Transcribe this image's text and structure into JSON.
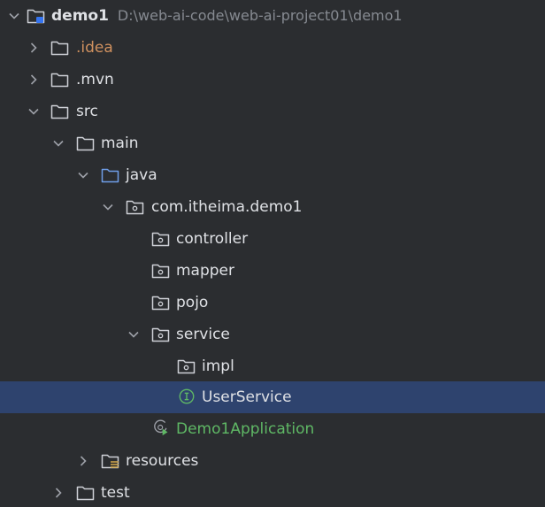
{
  "colors": {
    "background": "#2b2d30",
    "selection": "#2e436e",
    "text": "#dfe1e5",
    "muted": "#868a91",
    "excluded": "#d0915f",
    "application": "#5fb865",
    "source_folder": "#6f9ee8",
    "interface": "#5fb865"
  },
  "tree": {
    "root": {
      "name": "demo1",
      "path": "D:\\web-ai-code\\web-ai-project01\\demo1",
      "icon": "module-folder-icon",
      "expanded": true
    },
    "idea": {
      "name": ".idea",
      "icon": "folder-icon",
      "expanded": false
    },
    "mvn": {
      "name": ".mvn",
      "icon": "folder-icon",
      "expanded": false
    },
    "src": {
      "name": "src",
      "icon": "folder-icon",
      "expanded": true
    },
    "main": {
      "name": "main",
      "icon": "folder-icon",
      "expanded": true
    },
    "java": {
      "name": "java",
      "icon": "source-folder-icon",
      "expanded": true
    },
    "pkg": {
      "name": "com.itheima.demo1",
      "icon": "package-icon",
      "expanded": true
    },
    "controller": {
      "name": "controller",
      "icon": "package-icon"
    },
    "mapper": {
      "name": "mapper",
      "icon": "package-icon"
    },
    "pojo": {
      "name": "pojo",
      "icon": "package-icon"
    },
    "service": {
      "name": "service",
      "icon": "package-icon",
      "expanded": true
    },
    "impl": {
      "name": "impl",
      "icon": "package-icon"
    },
    "userservice": {
      "name": "UserService",
      "icon": "interface-icon",
      "selected": true
    },
    "app": {
      "name": "Demo1Application",
      "icon": "spring-boot-application-icon"
    },
    "resources": {
      "name": "resources",
      "icon": "resources-folder-icon",
      "expanded": false
    },
    "test": {
      "name": "test",
      "icon": "folder-icon",
      "expanded": false
    }
  }
}
